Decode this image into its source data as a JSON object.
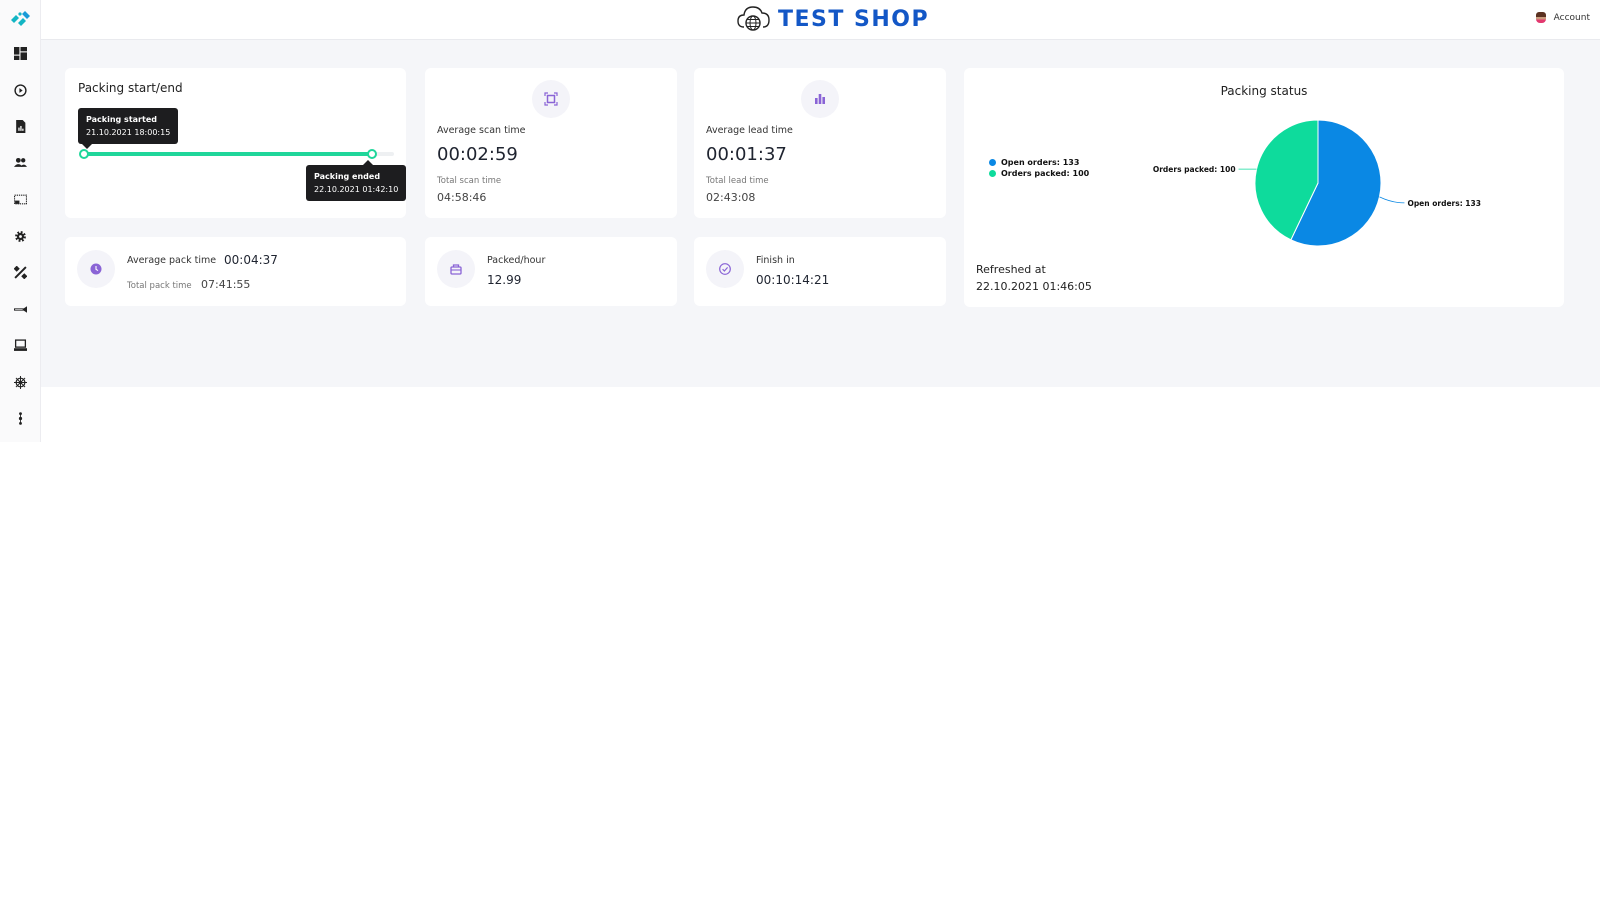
{
  "header": {
    "brand": "TEST SHOP",
    "account_label": "Account"
  },
  "sidebar": {
    "items": [
      {
        "name": "dashboard",
        "icon": "dashboard-icon"
      },
      {
        "name": "play",
        "icon": "play-circle-icon"
      },
      {
        "name": "reports",
        "icon": "report-document-icon"
      },
      {
        "name": "users",
        "icon": "users-icon"
      },
      {
        "name": "screen",
        "icon": "picture-in-picture-icon"
      },
      {
        "name": "settings",
        "icon": "gear-icon"
      },
      {
        "name": "tools",
        "icon": "tools-icon"
      },
      {
        "name": "announcements",
        "icon": "horn-icon"
      },
      {
        "name": "devices",
        "icon": "computer-icon"
      },
      {
        "name": "integrations",
        "icon": "hub-icon"
      },
      {
        "name": "more",
        "icon": "more-vertical-icon"
      }
    ]
  },
  "packing_start_end": {
    "title": "Packing start/end",
    "progress_fraction": 0.93,
    "start": {
      "label": "Packing started",
      "datetime": "21.10.2021 18:00:15"
    },
    "end": {
      "label": "Packing ended",
      "datetime": "22.10.2021 01:42:10"
    }
  },
  "scan": {
    "icon": "scan-icon",
    "label": "Average scan time",
    "value": "00:02:59",
    "sublabel": "Total scan time",
    "subvalue": "04:58:46"
  },
  "lead": {
    "icon": "bar-chart-icon",
    "label": "Average lead time",
    "value": "00:01:37",
    "sublabel": "Total lead time",
    "subvalue": "02:43:08"
  },
  "avg_pack": {
    "icon": "clock-icon",
    "label": "Average pack time",
    "value": "00:04:37",
    "sublabel": "Total pack time",
    "subvalue": "07:41:55"
  },
  "per_hour": {
    "icon": "package-icon",
    "label": "Packed/hour",
    "value": "12.99"
  },
  "finish": {
    "icon": "check-circle-icon",
    "label": "Finish in",
    "value": "00:10:14:21"
  },
  "packing_status": {
    "title": "Packing status",
    "refreshed_label": "Refreshed at",
    "refreshed_value": "22.10.2021 01:46:05",
    "legend": [
      {
        "label": "Open orders: 133",
        "color": "#0a88e4"
      },
      {
        "label": "Orders packed: 100",
        "color": "#0edb9c"
      }
    ]
  },
  "chart_data": {
    "type": "pie",
    "title": "Packing status",
    "categories": [
      "Open orders",
      "Orders packed"
    ],
    "values": [
      133,
      100
    ],
    "colors": [
      "#0a88e4",
      "#0edb9c"
    ],
    "data_labels": [
      "Open orders: 133",
      "Orders packed: 100"
    ],
    "legend_position": "left"
  }
}
